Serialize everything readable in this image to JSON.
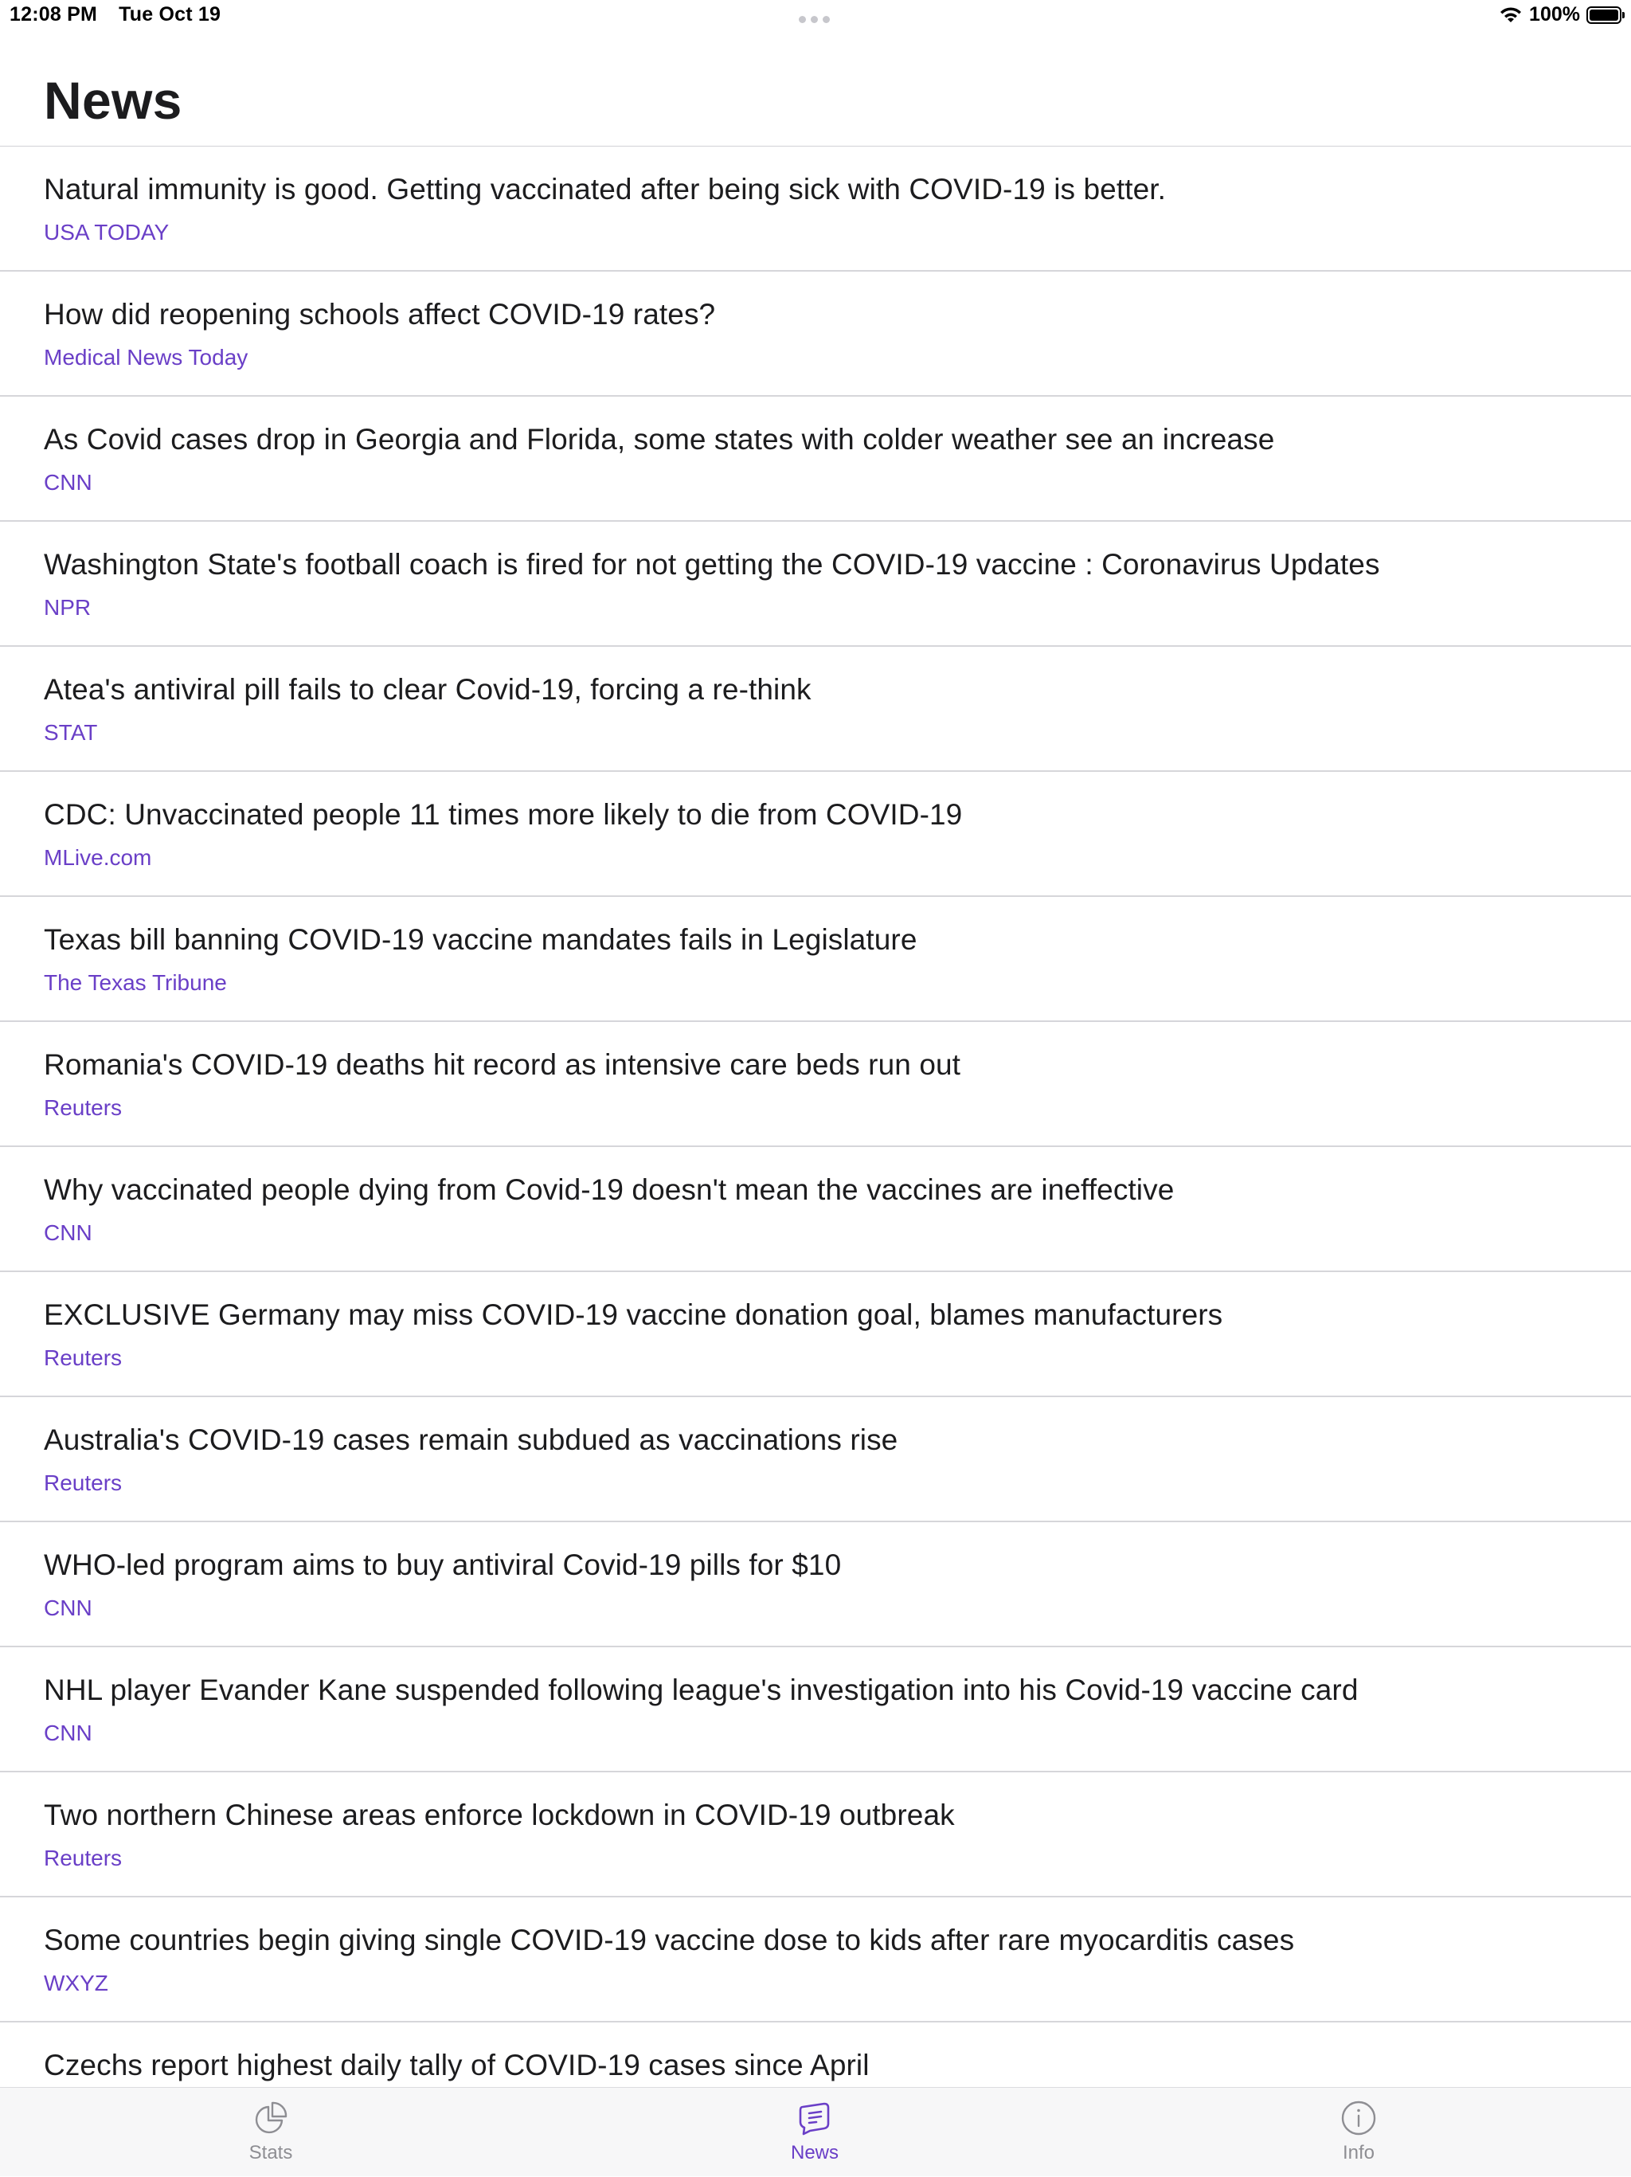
{
  "status_bar": {
    "time": "12:08 PM",
    "date": "Tue Oct 19",
    "battery": "100%"
  },
  "header": {
    "title": "News"
  },
  "colors": {
    "accent": "#6a3fc7",
    "inactive_tab": "#8e8e93",
    "divider": "#d6d6da"
  },
  "news": [
    {
      "title": "Natural immunity is good. Getting vaccinated after being sick with COVID-19 is better.",
      "source": "USA TODAY"
    },
    {
      "title": "How did reopening schools affect COVID-19 rates?",
      "source": "Medical News Today"
    },
    {
      "title": "As Covid cases drop in Georgia and Florida, some states with colder weather see an increase",
      "source": "CNN"
    },
    {
      "title": "Washington State's football coach is fired for not getting the COVID-19 vaccine : Coronavirus Updates",
      "source": "NPR"
    },
    {
      "title": "Atea's antiviral pill fails to clear Covid-19, forcing a re-think",
      "source": "STAT"
    },
    {
      "title": "CDC: Unvaccinated people 11 times more likely to die from COVID-19",
      "source": "MLive.com"
    },
    {
      "title": "Texas bill banning COVID-19 vaccine mandates fails in Legislature",
      "source": "The Texas Tribune"
    },
    {
      "title": "Romania's COVID-19 deaths hit record as intensive care beds run out",
      "source": "Reuters"
    },
    {
      "title": "Why vaccinated people dying from Covid-19 doesn't mean the vaccines are ineffective",
      "source": "CNN"
    },
    {
      "title": "EXCLUSIVE Germany may miss COVID-19 vaccine donation goal, blames manufacturers",
      "source": "Reuters"
    },
    {
      "title": "Australia's COVID-19 cases remain subdued as vaccinations rise",
      "source": "Reuters"
    },
    {
      "title": "WHO-led program aims to buy antiviral Covid-19 pills for $10",
      "source": "CNN"
    },
    {
      "title": "NHL player Evander Kane suspended following league's investigation into his Covid-19 vaccine card",
      "source": "CNN"
    },
    {
      "title": "Two northern Chinese areas enforce lockdown in COVID-19 outbreak",
      "source": "Reuters"
    },
    {
      "title": "Some countries begin giving single COVID-19 vaccine dose to kids after rare myocarditis cases",
      "source": "WXYZ"
    },
    {
      "title": "Czechs report highest daily tally of COVID-19 cases since April",
      "source": ""
    }
  ],
  "tabs": [
    {
      "label": "Stats",
      "icon": "pie-chart-icon",
      "active": false
    },
    {
      "label": "News",
      "icon": "news-bubble-icon",
      "active": true
    },
    {
      "label": "Info",
      "icon": "info-icon",
      "active": false
    }
  ]
}
